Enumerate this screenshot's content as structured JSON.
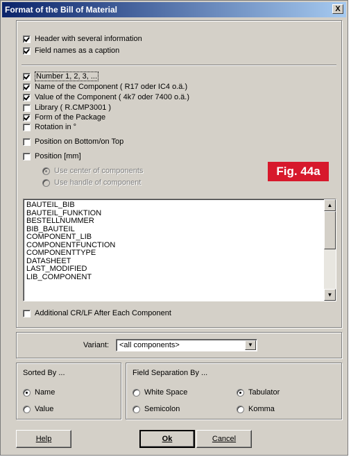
{
  "window": {
    "title": "Format of the Bill of Material",
    "close_label": "X"
  },
  "header_options": [
    {
      "label": "Header with several information",
      "checked": true
    },
    {
      "label": "Field names as a caption",
      "checked": true
    }
  ],
  "fields": [
    {
      "label": "Number 1, 2, 3, ...",
      "checked": true
    },
    {
      "label": "Name of the Component  ( R17 oder IC4 o.ä.)",
      "checked": true
    },
    {
      "label": "Value of the Component  ( 4k7 oder 7400 o.ä.)",
      "checked": true
    },
    {
      "label": "Library  ( R.CMP3001 )",
      "checked": false
    },
    {
      "label": "Form of the Package",
      "checked": true
    },
    {
      "label": "Rotation in °",
      "checked": false
    },
    {
      "label": "Position on Bottom/on Top",
      "checked": false
    },
    {
      "label": "Position [mm]",
      "checked": false
    }
  ],
  "position_options": [
    {
      "label": "Use center of components",
      "selected": true
    },
    {
      "label": "Use handle of component",
      "selected": false
    }
  ],
  "figure_label": "Fig. 44a",
  "attribute_list": [
    "BAUTEIL_BIB",
    "BAUTEIL_FUNKTION",
    "BESTELLNUMMER",
    "BIB_BAUTEIL",
    "COMPONENT_LIB",
    "COMPONENTFUNCTION",
    "COMPONENTTYPE",
    "DATASHEET",
    "LAST_MODIFIED",
    "LIB_COMPONENT"
  ],
  "crlf_option": {
    "label": "Additional CR/LF After Each Component",
    "checked": false
  },
  "variant": {
    "label": "Variant:",
    "value": "<all components>"
  },
  "sorted_by": {
    "title": "Sorted By ...",
    "options": [
      {
        "label": "Name",
        "selected": true
      },
      {
        "label": "Value",
        "selected": false
      }
    ]
  },
  "field_separation": {
    "title": "Field Separation By ...",
    "options": [
      {
        "label": "White Space",
        "selected": false
      },
      {
        "label": "Tabulator",
        "selected": true
      },
      {
        "label": "Semicolon",
        "selected": false
      },
      {
        "label": "Komma",
        "selected": false
      }
    ]
  },
  "buttons": {
    "help": "Help",
    "ok": "Ok",
    "cancel": "Cancel"
  }
}
